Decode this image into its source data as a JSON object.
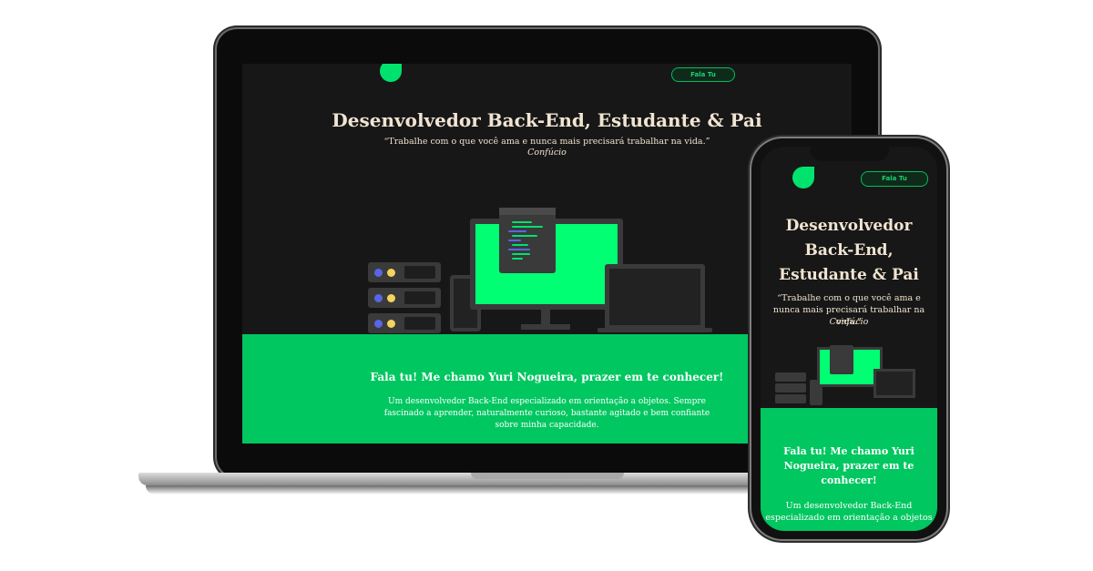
{
  "site": {
    "nav_button": "Fala Tu",
    "title": "Desenvolvedor Back-End, Estudante & Pai",
    "quote": "“Trabalhe com o que você ama e nunca mais precisará trabalhar na vida.”",
    "quote_author": "Confúcio",
    "hello": "Fala tu! Me chamo Yuri Nogueira, prazer em te conhecer!",
    "description": "Um desenvolvedor Back-End especializado em orientação a objetos. Sempre fascinado a aprender, naturalmente curioso, bastante agitado e bem confiante sobre minha capacidade.",
    "mobile_description": "Um desenvolvedor Back-End especializado em orientação a objetos"
  },
  "colors": {
    "accent_green": "#00c760",
    "logo_green": "#00e26e",
    "page_dark": "#171717",
    "text_cream": "#f1e4d2"
  },
  "icons": [
    "logo-leaf-icon",
    "server-rack-icon",
    "monitor-icon",
    "code-window-icon",
    "phone-device-icon",
    "laptop-device-icon"
  ]
}
